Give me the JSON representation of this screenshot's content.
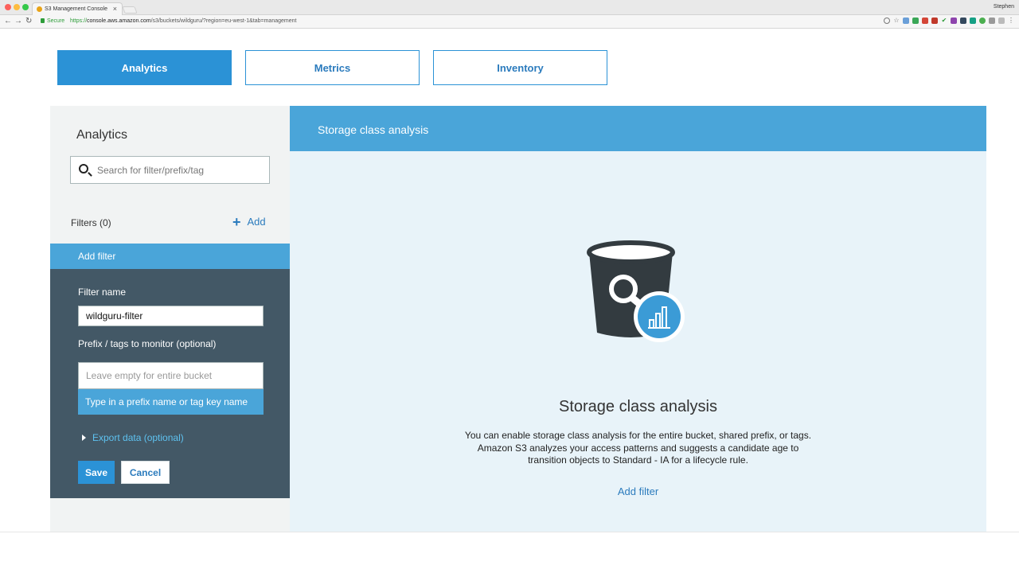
{
  "browser": {
    "tab_title": "S3 Management Console",
    "tab_close": "×",
    "user_name": "Stephen",
    "secure_label": "Secure",
    "url_scheme": "https://",
    "url_host": "console.aws.amazon.com",
    "url_path": "/s3/buckets/wildguru/?region=eu-west-1&tab=management",
    "back": "←",
    "forward": "→",
    "reload": "↻"
  },
  "tabs": [
    {
      "label": "Analytics",
      "active": true
    },
    {
      "label": "Metrics",
      "active": false
    },
    {
      "label": "Inventory",
      "active": false
    }
  ],
  "sidebar": {
    "title": "Analytics",
    "search_placeholder": "Search for filter/prefix/tag",
    "filters_label": "Filters (0)",
    "add_label": "Add",
    "add_icon": "+"
  },
  "filter_form": {
    "header": "Add filter",
    "filter_name_label": "Filter name",
    "filter_name_value": "wildguru-filter",
    "prefix_label": "Prefix / tags to monitor (optional)",
    "prefix_placeholder": "Leave empty for entire bucket",
    "suggestion": "Type in a prefix name or tag key name",
    "export_label": "Export data (optional)",
    "save_label": "Save",
    "cancel_label": "Cancel"
  },
  "main": {
    "header": "Storage class analysis",
    "title": "Storage class analysis",
    "description": "You can enable storage class analysis for the entire bucket, shared prefix, or tags. Amazon S3 analyzes your access patterns and suggests a candidate age to transition objects to Standard - IA for a lifecycle rule.",
    "add_filter_link": "Add filter"
  },
  "colors": {
    "accent": "#2b92d6",
    "header_blue": "#4aa5d9",
    "dark_panel": "#435866",
    "link": "#2b7bbd"
  }
}
